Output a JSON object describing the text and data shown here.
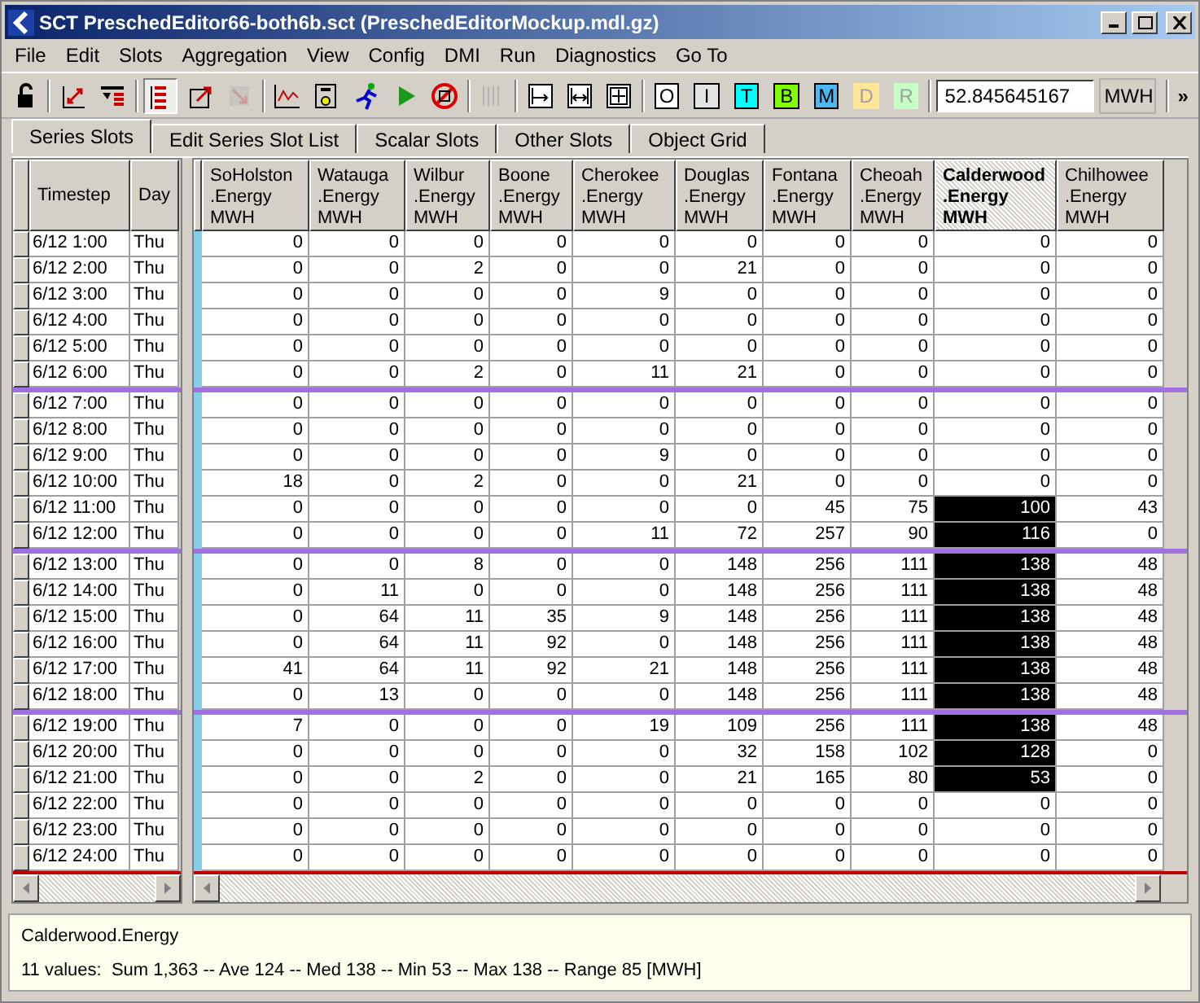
{
  "window": {
    "title": "SCT PreschedEditor66-both6b.sct (PreschedEditorMockup.mdl.gz)"
  },
  "menu": [
    "File",
    "Edit",
    "Slots",
    "Aggregation",
    "View",
    "Config",
    "DMI",
    "Run",
    "Diagnostics",
    "Go To"
  ],
  "toolbar": {
    "icon_buttons": [
      {
        "pressed": false,
        "disabled": false
      },
      {
        "pressed": false,
        "disabled": false
      },
      {
        "pressed": false,
        "disabled": false
      },
      {
        "pressed": true,
        "disabled": false
      },
      {
        "pressed": false,
        "disabled": false
      },
      {
        "pressed": false,
        "disabled": true
      },
      {
        "pressed": false,
        "disabled": false
      },
      {
        "pressed": false,
        "disabled": false
      },
      {
        "pressed": false,
        "disabled": false
      },
      {
        "pressed": false,
        "disabled": false
      },
      {
        "pressed": false,
        "disabled": false
      },
      {
        "pressed": false,
        "disabled": true
      },
      {
        "pressed": false,
        "disabled": false
      },
      {
        "pressed": false,
        "disabled": false
      },
      {
        "pressed": false,
        "disabled": false
      }
    ],
    "letter_buttons": [
      {
        "label": "O",
        "color": "#ffffff",
        "disabled": false
      },
      {
        "label": "I",
        "color": "#e4e4e4",
        "disabled": false
      },
      {
        "label": "T",
        "color": "#00ffff",
        "disabled": false
      },
      {
        "label": "B",
        "color": "#80ff00",
        "disabled": false
      },
      {
        "label": "M",
        "color": "#4db8f0",
        "disabled": false
      },
      {
        "label": "D",
        "color": "#ffe699",
        "disabled": true
      },
      {
        "label": "R",
        "color": "#c6ffc6",
        "disabled": true
      }
    ],
    "value_field": "52.845645167",
    "unit": "MWH",
    "overflow": "»"
  },
  "tabs": [
    {
      "label": "Series Slots",
      "selected": true
    },
    {
      "label": "Edit Series Slot List",
      "selected": false
    },
    {
      "label": "Scalar Slots",
      "selected": false
    },
    {
      "label": "Other Slots",
      "selected": false
    },
    {
      "label": "Object Grid",
      "selected": false
    }
  ],
  "table": {
    "row_columns": [
      "Timestep",
      "Day"
    ],
    "columns": [
      {
        "name": "SoHolston",
        "slot": ".Energy",
        "unit": "MWH",
        "selected": false
      },
      {
        "name": "Watauga",
        "slot": ".Energy",
        "unit": "MWH",
        "selected": false
      },
      {
        "name": "Wilbur",
        "slot": ".Energy",
        "unit": "MWH",
        "selected": false
      },
      {
        "name": "Boone",
        "slot": ".Energy",
        "unit": "MWH",
        "selected": false
      },
      {
        "name": "Cherokee",
        "slot": ".Energy",
        "unit": "MWH",
        "selected": false
      },
      {
        "name": "Douglas",
        "slot": ".Energy",
        "unit": "MWH",
        "selected": false
      },
      {
        "name": "Fontana",
        "slot": ".Energy",
        "unit": "MWH",
        "selected": false
      },
      {
        "name": "Cheoah",
        "slot": ".Energy",
        "unit": "MWH",
        "selected": false
      },
      {
        "name": "Calderwood",
        "slot": ".Energy",
        "unit": "MWH",
        "selected": true
      },
      {
        "name": "Chilhowee",
        "slot": ".Energy",
        "unit": "MWH",
        "selected": false
      }
    ],
    "blocks": [
      {
        "rows": [
          {
            "timestep": "6/12 1:00",
            "day": "Thu",
            "cells": [
              [
                "0",
                false
              ],
              [
                "0",
                false
              ],
              [
                "0",
                false
              ],
              [
                "0",
                false
              ],
              [
                "0",
                false
              ],
              [
                "0",
                false
              ],
              [
                "0",
                false
              ],
              [
                "0",
                false
              ],
              [
                "0",
                false
              ],
              [
                "0",
                false
              ]
            ]
          },
          {
            "timestep": "6/12 2:00",
            "day": "Thu",
            "cells": [
              [
                "0",
                false
              ],
              [
                "0",
                false
              ],
              [
                "2",
                false
              ],
              [
                "0",
                false
              ],
              [
                "0",
                false
              ],
              [
                "21",
                false
              ],
              [
                "0",
                false
              ],
              [
                "0",
                false
              ],
              [
                "0",
                false
              ],
              [
                "0",
                false
              ]
            ]
          },
          {
            "timestep": "6/12 3:00",
            "day": "Thu",
            "cells": [
              [
                "0",
                false
              ],
              [
                "0",
                false
              ],
              [
                "0",
                false
              ],
              [
                "0",
                false
              ],
              [
                "9",
                false
              ],
              [
                "0",
                false
              ],
              [
                "0",
                false
              ],
              [
                "0",
                false
              ],
              [
                "0",
                false
              ],
              [
                "0",
                false
              ]
            ]
          },
          {
            "timestep": "6/12 4:00",
            "day": "Thu",
            "cells": [
              [
                "0",
                false
              ],
              [
                "0",
                false
              ],
              [
                "0",
                false
              ],
              [
                "0",
                false
              ],
              [
                "0",
                false
              ],
              [
                "0",
                false
              ],
              [
                "0",
                false
              ],
              [
                "0",
                false
              ],
              [
                "0",
                false
              ],
              [
                "0",
                false
              ]
            ]
          },
          {
            "timestep": "6/12 5:00",
            "day": "Thu",
            "cells": [
              [
                "0",
                false
              ],
              [
                "0",
                false
              ],
              [
                "0",
                false
              ],
              [
                "0",
                false
              ],
              [
                "0",
                false
              ],
              [
                "0",
                false
              ],
              [
                "0",
                false
              ],
              [
                "0",
                false
              ],
              [
                "0",
                false
              ],
              [
                "0",
                false
              ]
            ]
          },
          {
            "timestep": "6/12 6:00",
            "day": "Thu",
            "cells": [
              [
                "0",
                false
              ],
              [
                "0",
                false
              ],
              [
                "2",
                false
              ],
              [
                "0",
                false
              ],
              [
                "11",
                false
              ],
              [
                "21",
                false
              ],
              [
                "0",
                false
              ],
              [
                "0",
                false
              ],
              [
                "0",
                false
              ],
              [
                "0",
                false
              ]
            ]
          }
        ]
      },
      {
        "rows": [
          {
            "timestep": "6/12 7:00",
            "day": "Thu",
            "cells": [
              [
                "0",
                false
              ],
              [
                "0",
                false
              ],
              [
                "0",
                false
              ],
              [
                "0",
                false
              ],
              [
                "0",
                false
              ],
              [
                "0",
                false
              ],
              [
                "0",
                false
              ],
              [
                "0",
                false
              ],
              [
                "0",
                false
              ],
              [
                "0",
                false
              ]
            ]
          },
          {
            "timestep": "6/12 8:00",
            "day": "Thu",
            "cells": [
              [
                "0",
                false
              ],
              [
                "0",
                false
              ],
              [
                "0",
                false
              ],
              [
                "0",
                false
              ],
              [
                "0",
                false
              ],
              [
                "0",
                false
              ],
              [
                "0",
                false
              ],
              [
                "0",
                false
              ],
              [
                "0",
                false
              ],
              [
                "0",
                false
              ]
            ]
          },
          {
            "timestep": "6/12 9:00",
            "day": "Thu",
            "cells": [
              [
                "0",
                false
              ],
              [
                "0",
                false
              ],
              [
                "0",
                false
              ],
              [
                "0",
                false
              ],
              [
                "9",
                false
              ],
              [
                "0",
                false
              ],
              [
                "0",
                false
              ],
              [
                "0",
                false
              ],
              [
                "0",
                false
              ],
              [
                "0",
                false
              ]
            ]
          },
          {
            "timestep": "6/12 10:00",
            "day": "Thu",
            "cells": [
              [
                "18",
                false
              ],
              [
                "0",
                false
              ],
              [
                "2",
                false
              ],
              [
                "0",
                false
              ],
              [
                "0",
                false
              ],
              [
                "21",
                false
              ],
              [
                "0",
                false
              ],
              [
                "0",
                false
              ],
              [
                "0",
                false
              ],
              [
                "0",
                false
              ]
            ]
          },
          {
            "timestep": "6/12 11:00",
            "day": "Thu",
            "cells": [
              [
                "0",
                false
              ],
              [
                "0",
                false
              ],
              [
                "0",
                false
              ],
              [
                "0",
                false
              ],
              [
                "0",
                false
              ],
              [
                "0",
                false
              ],
              [
                "45",
                false
              ],
              [
                "75",
                false
              ],
              [
                "100",
                true
              ],
              [
                "43",
                false
              ]
            ]
          },
          {
            "timestep": "6/12 12:00",
            "day": "Thu",
            "cells": [
              [
                "0",
                false
              ],
              [
                "0",
                false
              ],
              [
                "0",
                false
              ],
              [
                "0",
                false
              ],
              [
                "11",
                false
              ],
              [
                "72",
                false
              ],
              [
                "257",
                false
              ],
              [
                "90",
                false
              ],
              [
                "116",
                true
              ],
              [
                "0",
                false
              ]
            ]
          }
        ]
      },
      {
        "rows": [
          {
            "timestep": "6/12 13:00",
            "day": "Thu",
            "cells": [
              [
                "0",
                false
              ],
              [
                "0",
                false
              ],
              [
                "8",
                false
              ],
              [
                "0",
                false
              ],
              [
                "0",
                false
              ],
              [
                "148",
                false
              ],
              [
                "256",
                false
              ],
              [
                "111",
                false
              ],
              [
                "138",
                true
              ],
              [
                "48",
                false
              ]
            ]
          },
          {
            "timestep": "6/12 14:00",
            "day": "Thu",
            "cells": [
              [
                "0",
                false
              ],
              [
                "11",
                false
              ],
              [
                "0",
                false
              ],
              [
                "0",
                false
              ],
              [
                "0",
                false
              ],
              [
                "148",
                false
              ],
              [
                "256",
                false
              ],
              [
                "111",
                false
              ],
              [
                "138",
                true
              ],
              [
                "48",
                false
              ]
            ]
          },
          {
            "timestep": "6/12 15:00",
            "day": "Thu",
            "cells": [
              [
                "0",
                false
              ],
              [
                "64",
                false
              ],
              [
                "11",
                false
              ],
              [
                "35",
                false
              ],
              [
                "9",
                false
              ],
              [
                "148",
                false
              ],
              [
                "256",
                false
              ],
              [
                "111",
                false
              ],
              [
                "138",
                true
              ],
              [
                "48",
                false
              ]
            ]
          },
          {
            "timestep": "6/12 16:00",
            "day": "Thu",
            "cells": [
              [
                "0",
                false
              ],
              [
                "64",
                false
              ],
              [
                "11",
                false
              ],
              [
                "92",
                false
              ],
              [
                "0",
                false
              ],
              [
                "148",
                false
              ],
              [
                "256",
                false
              ],
              [
                "111",
                false
              ],
              [
                "138",
                true
              ],
              [
                "48",
                false
              ]
            ]
          },
          {
            "timestep": "6/12 17:00",
            "day": "Thu",
            "cells": [
              [
                "41",
                false
              ],
              [
                "64",
                false
              ],
              [
                "11",
                false
              ],
              [
                "92",
                false
              ],
              [
                "21",
                false
              ],
              [
                "148",
                false
              ],
              [
                "256",
                false
              ],
              [
                "111",
                false
              ],
              [
                "138",
                true
              ],
              [
                "48",
                false
              ]
            ]
          },
          {
            "timestep": "6/12 18:00",
            "day": "Thu",
            "cells": [
              [
                "0",
                false
              ],
              [
                "13",
                false
              ],
              [
                "0",
                false
              ],
              [
                "0",
                false
              ],
              [
                "0",
                false
              ],
              [
                "148",
                false
              ],
              [
                "256",
                false
              ],
              [
                "111",
                false
              ],
              [
                "138",
                true
              ],
              [
                "48",
                false
              ]
            ]
          }
        ]
      },
      {
        "rows": [
          {
            "timestep": "6/12 19:00",
            "day": "Thu",
            "cells": [
              [
                "7",
                false
              ],
              [
                "0",
                false
              ],
              [
                "0",
                false
              ],
              [
                "0",
                false
              ],
              [
                "19",
                false
              ],
              [
                "109",
                false
              ],
              [
                "256",
                false
              ],
              [
                "111",
                false
              ],
              [
                "138",
                true
              ],
              [
                "48",
                false
              ]
            ]
          },
          {
            "timestep": "6/12 20:00",
            "day": "Thu",
            "cells": [
              [
                "0",
                false
              ],
              [
                "0",
                false
              ],
              [
                "0",
                false
              ],
              [
                "0",
                false
              ],
              [
                "0",
                false
              ],
              [
                "32",
                false
              ],
              [
                "158",
                false
              ],
              [
                "102",
                false
              ],
              [
                "128",
                true
              ],
              [
                "0",
                false
              ]
            ]
          },
          {
            "timestep": "6/12 21:00",
            "day": "Thu",
            "cells": [
              [
                "0",
                false
              ],
              [
                "0",
                false
              ],
              [
                "2",
                false
              ],
              [
                "0",
                false
              ],
              [
                "0",
                false
              ],
              [
                "21",
                false
              ],
              [
                "165",
                false
              ],
              [
                "80",
                false
              ],
              [
                "53",
                true
              ],
              [
                "0",
                false
              ]
            ]
          },
          {
            "timestep": "6/12 22:00",
            "day": "Thu",
            "cells": [
              [
                "0",
                false
              ],
              [
                "0",
                false
              ],
              [
                "0",
                false
              ],
              [
                "0",
                false
              ],
              [
                "0",
                false
              ],
              [
                "0",
                false
              ],
              [
                "0",
                false
              ],
              [
                "0",
                false
              ],
              [
                "0",
                false
              ],
              [
                "0",
                false
              ]
            ]
          },
          {
            "timestep": "6/12 23:00",
            "day": "Thu",
            "cells": [
              [
                "0",
                false
              ],
              [
                "0",
                false
              ],
              [
                "0",
                false
              ],
              [
                "0",
                false
              ],
              [
                "0",
                false
              ],
              [
                "0",
                false
              ],
              [
                "0",
                false
              ],
              [
                "0",
                false
              ],
              [
                "0",
                false
              ],
              [
                "0",
                false
              ]
            ]
          },
          {
            "timestep": "6/12 24:00",
            "day": "Thu",
            "cells": [
              [
                "0",
                false
              ],
              [
                "0",
                false
              ],
              [
                "0",
                false
              ],
              [
                "0",
                false
              ],
              [
                "0",
                false
              ],
              [
                "0",
                false
              ],
              [
                "0",
                false
              ],
              [
                "0",
                false
              ],
              [
                "0",
                false
              ],
              [
                "0",
                false
              ]
            ]
          }
        ]
      }
    ]
  },
  "status": {
    "slot": "Calderwood.Energy",
    "summary": "11 values:  Sum 1,363 -- Ave 124 -- Med 138 -- Min 53 -- Max 138 -- Range 85 [MWH]"
  }
}
